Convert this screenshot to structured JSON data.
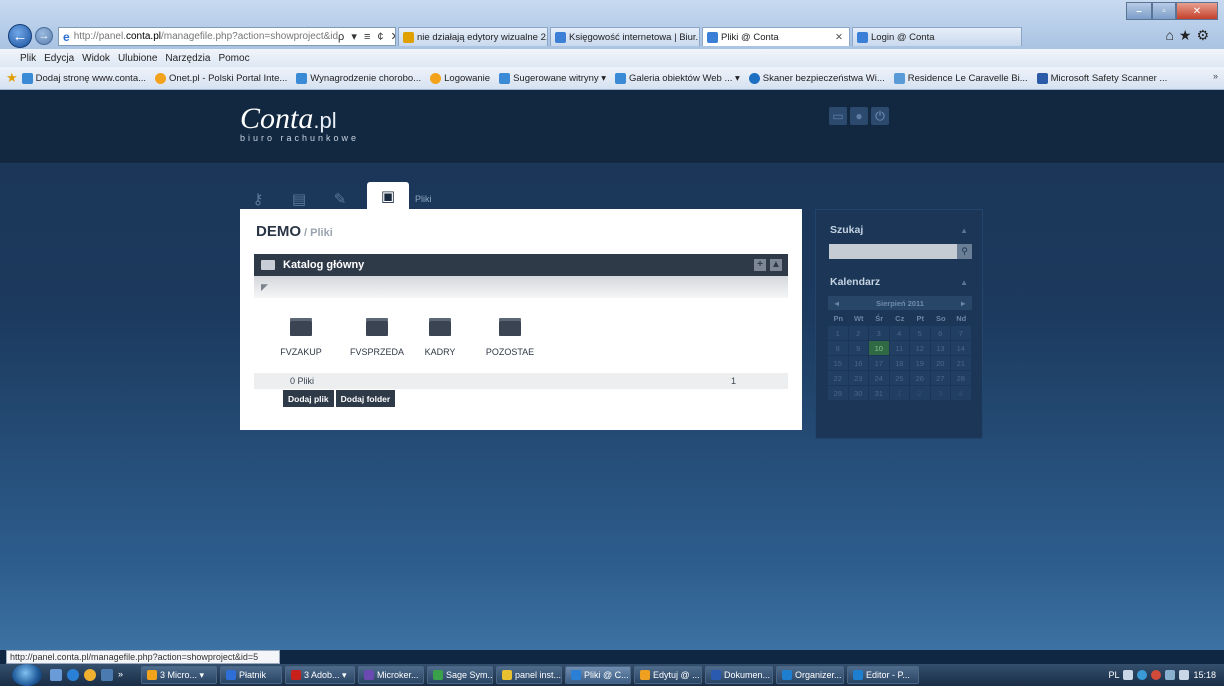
{
  "browser": {
    "address_prefix": "http://panel.",
    "address_domain": "conta.pl",
    "address_path": "/managefile.php?action=showproject&id",
    "address_tools": "ρ ▾ ≡ ¢ ✕",
    "tabs": [
      {
        "label": "nie działają edytory wizualne 2..."
      },
      {
        "label": "Księgowość internetowa | Biur..."
      },
      {
        "label": "Pliki @ Conta"
      },
      {
        "label": "Login @ Conta"
      }
    ],
    "menu": [
      "Plik",
      "Edycja",
      "Widok",
      "Ulubione",
      "Narzędzia",
      "Pomoc"
    ],
    "favorites": [
      {
        "label": "Dodaj stronę www.conta...",
        "color": "#3b8ad6"
      },
      {
        "label": "Onet.pl - Polski Portal Inte...",
        "color": "#f2a31b"
      },
      {
        "label": "Wynagrodzenie chorobo...",
        "color": "#3b8ad6"
      },
      {
        "label": "Logowanie",
        "color": "#f2a31b"
      },
      {
        "label": "Sugerowane witryny ▾",
        "color": "#3b8ad6"
      },
      {
        "label": "Galeria obiektów Web ... ▾",
        "color": "#3b8ad6"
      },
      {
        "label": "Skaner bezpieczeństwa Wi...",
        "color": "#1d6fc2"
      },
      {
        "label": "Residence Le Caravelle Bi...",
        "color": "#5a9ad6"
      },
      {
        "label": "Microsoft Safety Scanner ...",
        "color": "#2a5aa8"
      }
    ],
    "status_url": "http://panel.conta.pl/managefile.php?action=showproject&id=5"
  },
  "site": {
    "logo_main": "Conta",
    "logo_suffix": ".pl",
    "logo_sub": "biuro rachunkowe",
    "active_tab_label": "Pliki",
    "breadcrumb_project": "DEMO",
    "breadcrumb_section": " / Pliki",
    "folder_title": "Katalog główny",
    "folders": [
      "FVZAKUP",
      "FVSPRZEDA",
      "KADRY",
      "POZOSTAE"
    ],
    "file_count": "0 Pliki",
    "page_number": "1",
    "btn_add_file": "Dodaj plik",
    "btn_add_folder": "Dodaj folder"
  },
  "sidebar": {
    "search_title": "Szukaj",
    "calendar_title": "Kalendarz",
    "month_label": "Sierpień 2011",
    "prev": "◄",
    "next": "►",
    "day_names": [
      "Pn",
      "Wt",
      "Śr",
      "Cz",
      "Pt",
      "So",
      "Nd"
    ],
    "weeks": [
      [
        "1",
        "2",
        "3",
        "4",
        "5",
        "6",
        "7"
      ],
      [
        "8",
        "9",
        "10",
        "11",
        "12",
        "13",
        "14"
      ],
      [
        "15",
        "16",
        "17",
        "18",
        "19",
        "20",
        "21"
      ],
      [
        "22",
        "23",
        "24",
        "25",
        "26",
        "27",
        "28"
      ],
      [
        "29",
        "30",
        "31",
        "1",
        "2",
        "3",
        "4"
      ]
    ],
    "today": "10"
  },
  "taskbar": {
    "items": [
      {
        "label": "3 Micro... ▾",
        "color": "#f2a31b"
      },
      {
        "label": "Płatnik",
        "color": "#2d6fd6"
      },
      {
        "label": "3 Adob... ▾",
        "color": "#c8201a"
      },
      {
        "label": "Microker...",
        "color": "#6a4ab0"
      },
      {
        "label": "Sage Sym...",
        "color": "#3aa04a"
      },
      {
        "label": "panel inst...",
        "color": "#e8c030"
      },
      {
        "label": "Pliki @ C...",
        "color": "#2a7fd6"
      },
      {
        "label": "Edytuj @ ...",
        "color": "#f0a020"
      },
      {
        "label": "Dokumen...",
        "color": "#2a5ab0"
      },
      {
        "label": "Organizer...",
        "color": "#1e7fd0"
      },
      {
        "label": "Editor - P...",
        "color": "#1e7fd0"
      }
    ],
    "lang": "PL",
    "clock": "15:18"
  }
}
